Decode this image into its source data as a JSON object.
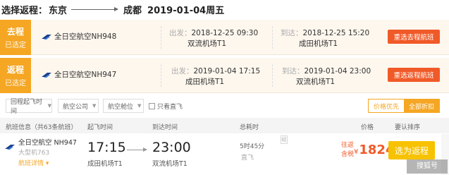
{
  "header": {
    "label": "选择返程：",
    "from": "东京",
    "to": "成都",
    "date": "2019-01-04周五"
  },
  "legs": [
    {
      "badge_title": "去程",
      "badge_status": "已选定",
      "airline": "全日空航空NH948",
      "dep_label": "出发：",
      "dep_time": "2018-12-25 09:30",
      "dep_airport": "双流机场T1",
      "arr_label": "到达：",
      "arr_time": "2018-12-25 15:20",
      "arr_airport": "成田机场T1",
      "button": "重选去程航班"
    },
    {
      "badge_title": "返程",
      "badge_status": "已选定",
      "airline": "全日空航空NH947",
      "dep_label": "出发：",
      "dep_time": "2019-01-04 17:15",
      "dep_airport": "成田机场T1",
      "arr_label": "到达：",
      "arr_time": "2019-01-04 23:00",
      "arr_airport": "双流机场T1",
      "button": "重选返程航班"
    }
  ],
  "filters": {
    "items": [
      "回程起飞时间",
      "航空公司",
      "航空舱位"
    ],
    "checkbox": "只看直飞",
    "sort_tabs": [
      "价格优先",
      "全部折扣"
    ]
  },
  "columns": {
    "flight_info": "航班信息（共63条航班）",
    "dep_time": "起飞时间",
    "arr_time": "到达时间",
    "duration": "总耗时",
    "price": "价格",
    "note": "要认排序"
  },
  "row": {
    "airline": "全日空航空 NH947",
    "model": "大型机763",
    "detail": "航班详情",
    "dep_time": "17:15",
    "dep_airport": "成田机场T1",
    "arr_time": "23:00",
    "arr_airport": "双流机场T1",
    "duration": "5时45分",
    "stop": "直飞",
    "badge": "经",
    "price_tag_top": "往返",
    "price_tag_bottom": "含税",
    "currency": "¥",
    "price": "1824",
    "select": "选为返程"
  },
  "watermark": "搜狐号",
  "colors": {
    "accent": "#f5a623",
    "price": "#f05a28",
    "select": "#f7c200"
  }
}
